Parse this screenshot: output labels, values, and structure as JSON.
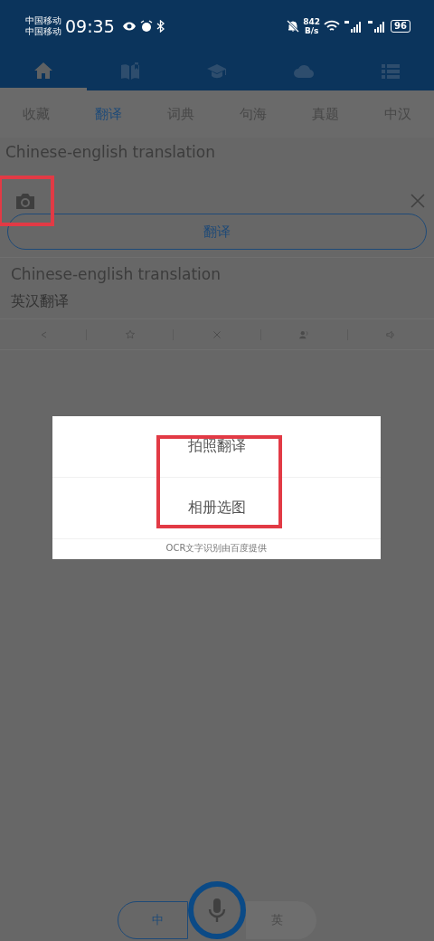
{
  "status_bar": {
    "carriers": [
      "中国移动",
      "中国移动"
    ],
    "time": "09:35",
    "net_speed": [
      "842",
      "B/s"
    ],
    "battery": "96"
  },
  "nav": [
    {
      "kind": "home",
      "selected": true
    },
    {
      "kind": "book",
      "selected": false
    },
    {
      "kind": "cap",
      "selected": false
    },
    {
      "kind": "cloud",
      "selected": false
    },
    {
      "kind": "list",
      "selected": false
    }
  ],
  "tabs": [
    {
      "label": "收藏",
      "selected": false
    },
    {
      "label": "翻译",
      "selected": true
    },
    {
      "label": "词典",
      "selected": false
    },
    {
      "label": "句海",
      "selected": false
    },
    {
      "label": "真题",
      "selected": false
    },
    {
      "label": "中汉",
      "selected": false
    }
  ],
  "input": {
    "value": "Chinese-english translation",
    "camera_highlighted": true
  },
  "translate_button": "翻译",
  "result": {
    "source": "Chinese-english translation",
    "translation": "英汉翻译"
  },
  "actions": [
    {
      "kind": "share"
    },
    {
      "kind": "star"
    },
    {
      "kind": "close"
    },
    {
      "kind": "speaker"
    },
    {
      "kind": "volume"
    }
  ],
  "dialog": {
    "highlighted": true,
    "options": [
      "拍照翻译",
      "相册选图"
    ],
    "footer": "OCR文字识别由百度提供"
  },
  "language_toggle": [
    {
      "label": "中",
      "selected": true
    },
    {
      "label": "英",
      "selected": false
    }
  ]
}
